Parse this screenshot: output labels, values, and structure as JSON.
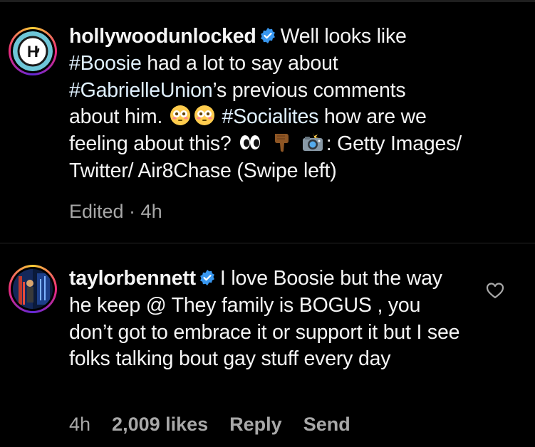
{
  "caption": {
    "username": "hollywoodunlocked",
    "line1": "Well looks like",
    "hashtag_boosie": "#Boosie",
    "line2_rest": " had a lot to say about",
    "hashtag_gabrielle": "#GabrielleUnion",
    "line3_rest": "’s previous comments",
    "line4_start": "about him.",
    "hashtag_socialites": "#Socialites",
    "line4_rest": " how are we",
    "line5_start": "feeling about this?",
    "line5_rest": ": Getty Images/",
    "line6": "Twitter/ Air8Chase (Swipe left)",
    "meta": "Edited · 4h"
  },
  "comment": {
    "username": "taylorbennett",
    "text_line1": "I love Boosie but the",
    "text_rest": "way he keep @ They family is BOGUS , you don’t got to embrace it or support it but I see folks talking bout gay stuff every day",
    "time": "4h",
    "likes": "2,009 likes",
    "reply_label": "Reply",
    "send_label": "Send"
  },
  "icons": {
    "verified": "verified-badge-icon",
    "heart": "heart-outline-icon",
    "flushed": "flushed-face-emoji",
    "eyes": "eyes-emoji",
    "point_down": "backhand-index-pointing-down-emoji",
    "camera_flash": "camera-with-flash-emoji"
  },
  "colors": {
    "background": "#000000",
    "text": "#f5f5f5",
    "muted": "#a8a8a8",
    "hashtag": "#e0f1ff",
    "verified": "#3897f0"
  }
}
